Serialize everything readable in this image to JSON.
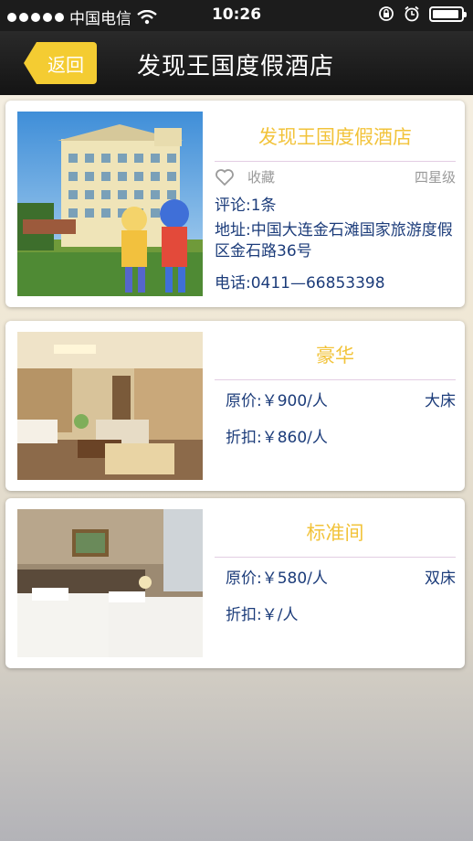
{
  "status_bar": {
    "carrier": "中国电信",
    "time": "10:26"
  },
  "nav": {
    "back_label": "返回",
    "title": "发现王国度假酒店"
  },
  "hotel": {
    "name": "发现王国度假酒店",
    "favorite_label": "收藏",
    "rating": "四星级",
    "reviews": "评论:1条",
    "address": "地址:中国大连金石滩国家旅游度假区金石路36号",
    "phone": "电话:0411—66853398"
  },
  "rooms": [
    {
      "name": "豪华",
      "original_price": "原价:￥900/人",
      "bed": "大床",
      "discount_price": "折扣:￥860/人"
    },
    {
      "name": "标准间",
      "original_price": "原价:￥580/人",
      "bed": "双床",
      "discount_price": "折扣:￥/人"
    }
  ]
}
